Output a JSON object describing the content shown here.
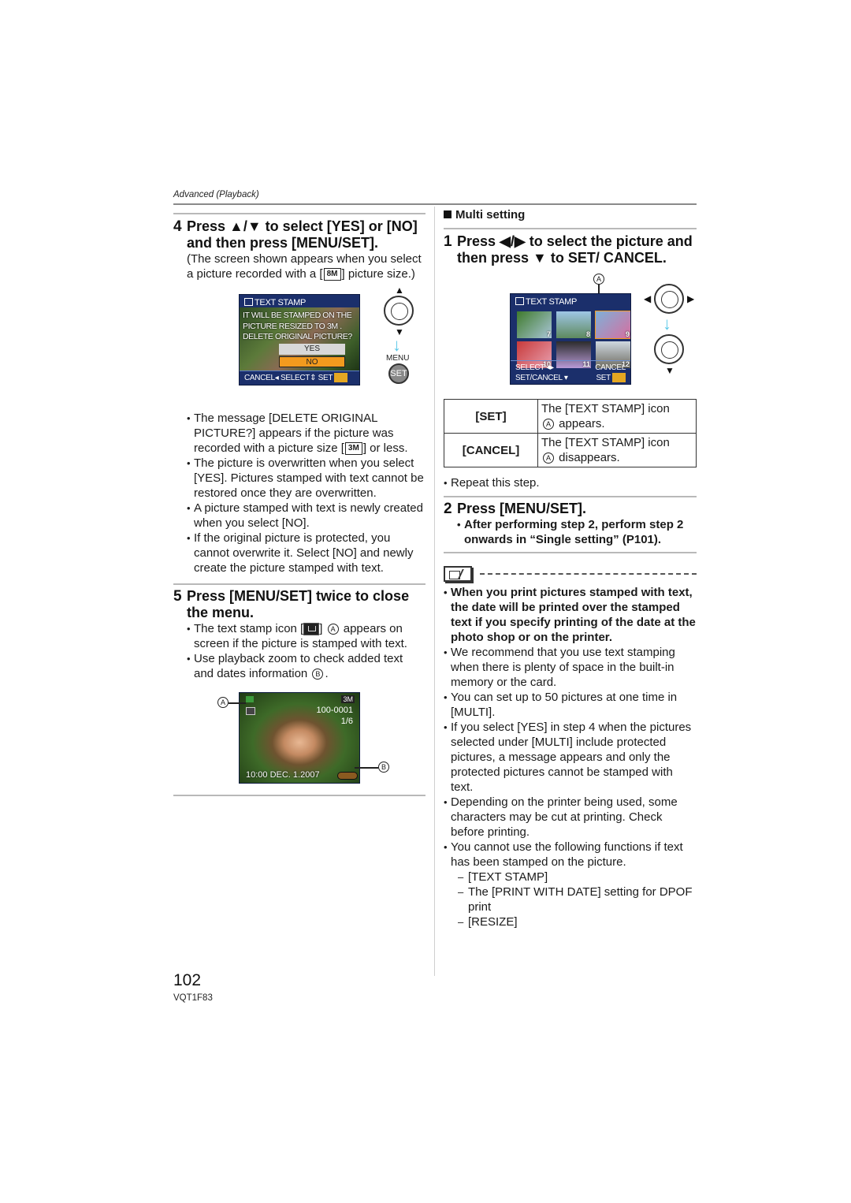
{
  "header": {
    "section_label": "Advanced (Playback)"
  },
  "left": {
    "step4": {
      "number": "4",
      "title": "Press ▲/▼ to select [YES] or [NO] and then press [MENU/SET].",
      "note_before": "(The screen shown appears when you select a picture recorded with a [",
      "note_icon": "8M",
      "note_after": "] picture size.)"
    },
    "screen1": {
      "title": "TEXT STAMP",
      "message_lines": [
        "IT WILL BE STAMPED ON THE",
        "PICTURE RESIZED TO 3M .",
        "DELETE ORIGINAL PICTURE?"
      ],
      "option_yes": "YES",
      "option_no": "NO",
      "footer": "CANCEL◂  SELECT⇕  SET",
      "side_label": "MENU",
      "set_label": "SET"
    },
    "bullets_step4": [
      {
        "before": "The message [DELETE ORIGINAL PICTURE?] appears if the picture was recorded with a picture size [",
        "icon": "3M",
        "after": "] or less."
      },
      {
        "text": "The picture is overwritten when you select [YES]. Pictures stamped with text cannot be restored once they are overwritten."
      },
      {
        "text": "A picture stamped with text is newly created when you select [NO]."
      },
      {
        "text": "If the original picture is protected, you cannot overwrite it. Select [NO] and newly create the picture stamped with text."
      }
    ],
    "step5": {
      "number": "5",
      "title": "Press [MENU/SET] twice to close the menu."
    },
    "bullets_step5": [
      {
        "before": "The text stamp icon [",
        "after": "] ",
        "callout": "A",
        "after2": " appears on screen if the picture is stamped with text."
      },
      {
        "before": "Use playback zoom to check added text and dates information ",
        "callout": "B",
        "after": "."
      }
    ],
    "screen2": {
      "size_badge": "3M",
      "file_no": "100-0001",
      "count": "1/6",
      "datetime": "10:00 DEC. 1.2007",
      "callout_a": "A",
      "callout_b": "B"
    }
  },
  "right": {
    "section_heading": "Multi setting",
    "step1": {
      "number": "1",
      "title": "Press ◀/▶ to select the picture and then press ▼ to SET/ CANCEL."
    },
    "screen3": {
      "callout": "A",
      "title": "TEXT STAMP",
      "thumb_numbers": [
        "7",
        "8",
        "9",
        "10",
        "11",
        "12"
      ],
      "footer_left_1": "SELECT ◂▸",
      "footer_left_2": "SET/CANCEL ▾",
      "footer_right_1": "CANCEL",
      "footer_right_2": "SET"
    },
    "table": [
      {
        "key": "[SET]",
        "value_before": "The [TEXT STAMP] icon",
        "callout": "A",
        "value_after": "appears."
      },
      {
        "key": "[CANCEL]",
        "value_before": "The [TEXT STAMP] icon",
        "callout": "A",
        "value_after": "disappears."
      }
    ],
    "repeat_note": "Repeat this step.",
    "step2": {
      "number": "2",
      "title": "Press [MENU/SET].",
      "bullet": "After performing step 2, perform step 2 onwards in “Single setting” (P101)."
    },
    "notes_bold": [
      "When you print pictures stamped with text, the date will be printed over the stamped text if you specify printing of the date at the photo shop or on the printer."
    ],
    "notes": [
      "We recommend that you use text stamping when there is plenty of space in the built-in memory or the card.",
      "You can set up to 50 pictures at one time in [MULTI].",
      "If you select [YES] in step 4 when the pictures selected under [MULTI] include protected pictures, a message appears and only the protected pictures cannot be stamped with text.",
      "Depending on the printer being used, some characters may be cut at printing. Check before printing.",
      "You cannot use the following functions if text has been stamped on the picture."
    ],
    "sub_list": [
      "[TEXT STAMP]",
      "The [PRINT WITH DATE] setting for DPOF print",
      "[RESIZE]"
    ]
  },
  "footer": {
    "page_number": "102",
    "model_code": "VQT1F83"
  }
}
